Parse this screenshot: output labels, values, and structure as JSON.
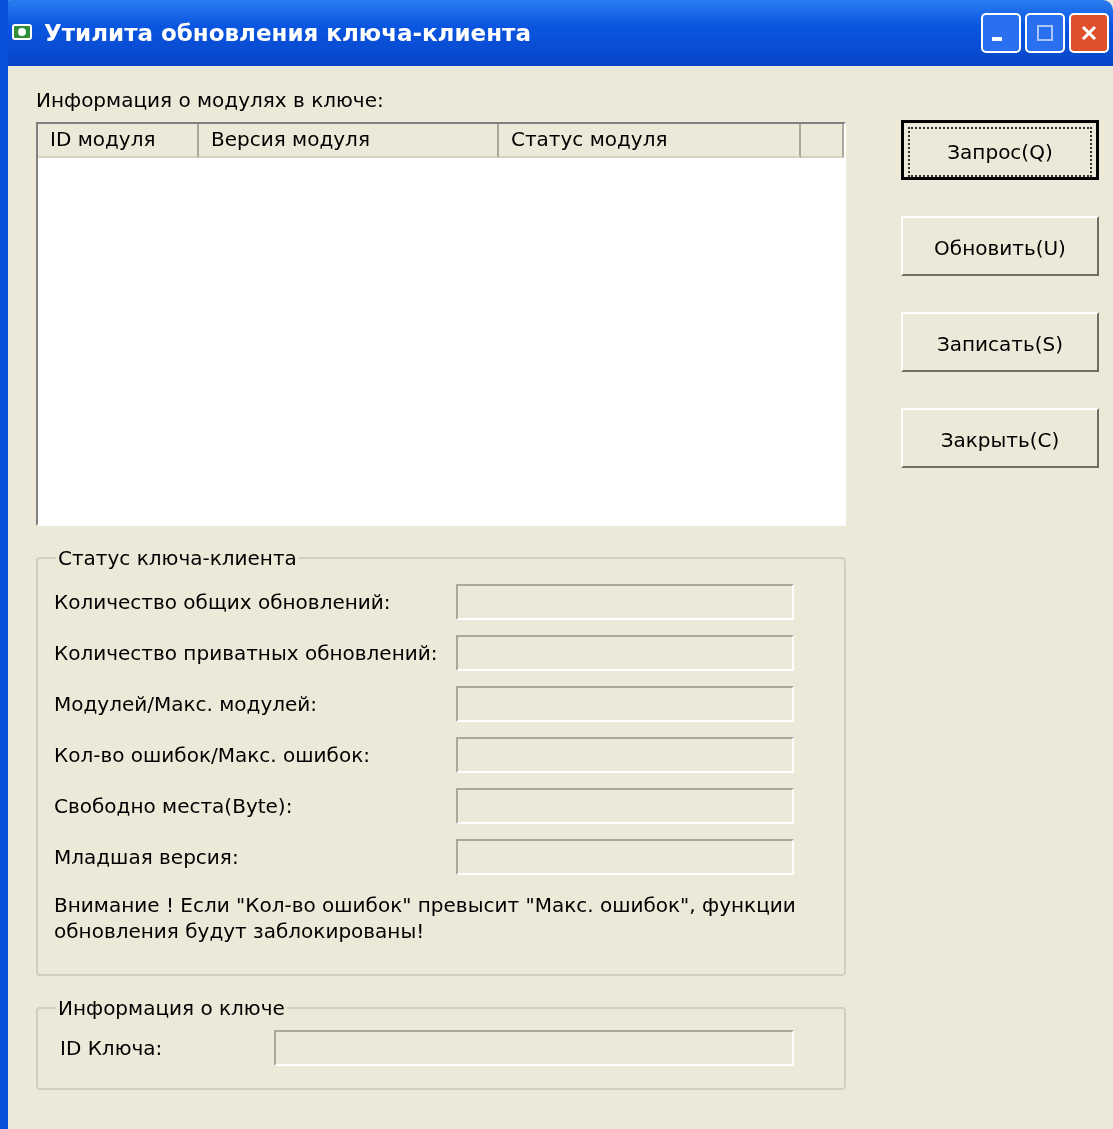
{
  "window": {
    "title": "Утилита обновления ключа-клиента"
  },
  "modules": {
    "label": "Информация о модулях в ключе:",
    "columns": [
      "ID модуля",
      "Версия модуля",
      "Статус модуля"
    ]
  },
  "buttons": [
    {
      "label": "Запрос(Q)",
      "focused": true
    },
    {
      "label": "Обновить(U)",
      "focused": false
    },
    {
      "label": "Записать(S)",
      "focused": false
    },
    {
      "label": "Закрыть(C)",
      "focused": false
    }
  ],
  "client_status": {
    "title": "Статус ключа-клиента",
    "fields": [
      {
        "label": "Количество общих обновлений:"
      },
      {
        "label": "Количество приватных обновлений:"
      },
      {
        "label": "Модулей/Макс. модулей:"
      },
      {
        "label": "Кол-во ошибок/Макс. ошибок:"
      },
      {
        "label": "Свободно места(Byte):"
      },
      {
        "label": "Младшая версия:"
      }
    ],
    "warning": "Внимание ! Если \"Кол-во ошибок\" превысит \"Макс. ошибок\", функции обновления будут заблокированы!"
  },
  "key_info": {
    "title": "Информация о ключе",
    "field_label": "ID Ключа:"
  }
}
